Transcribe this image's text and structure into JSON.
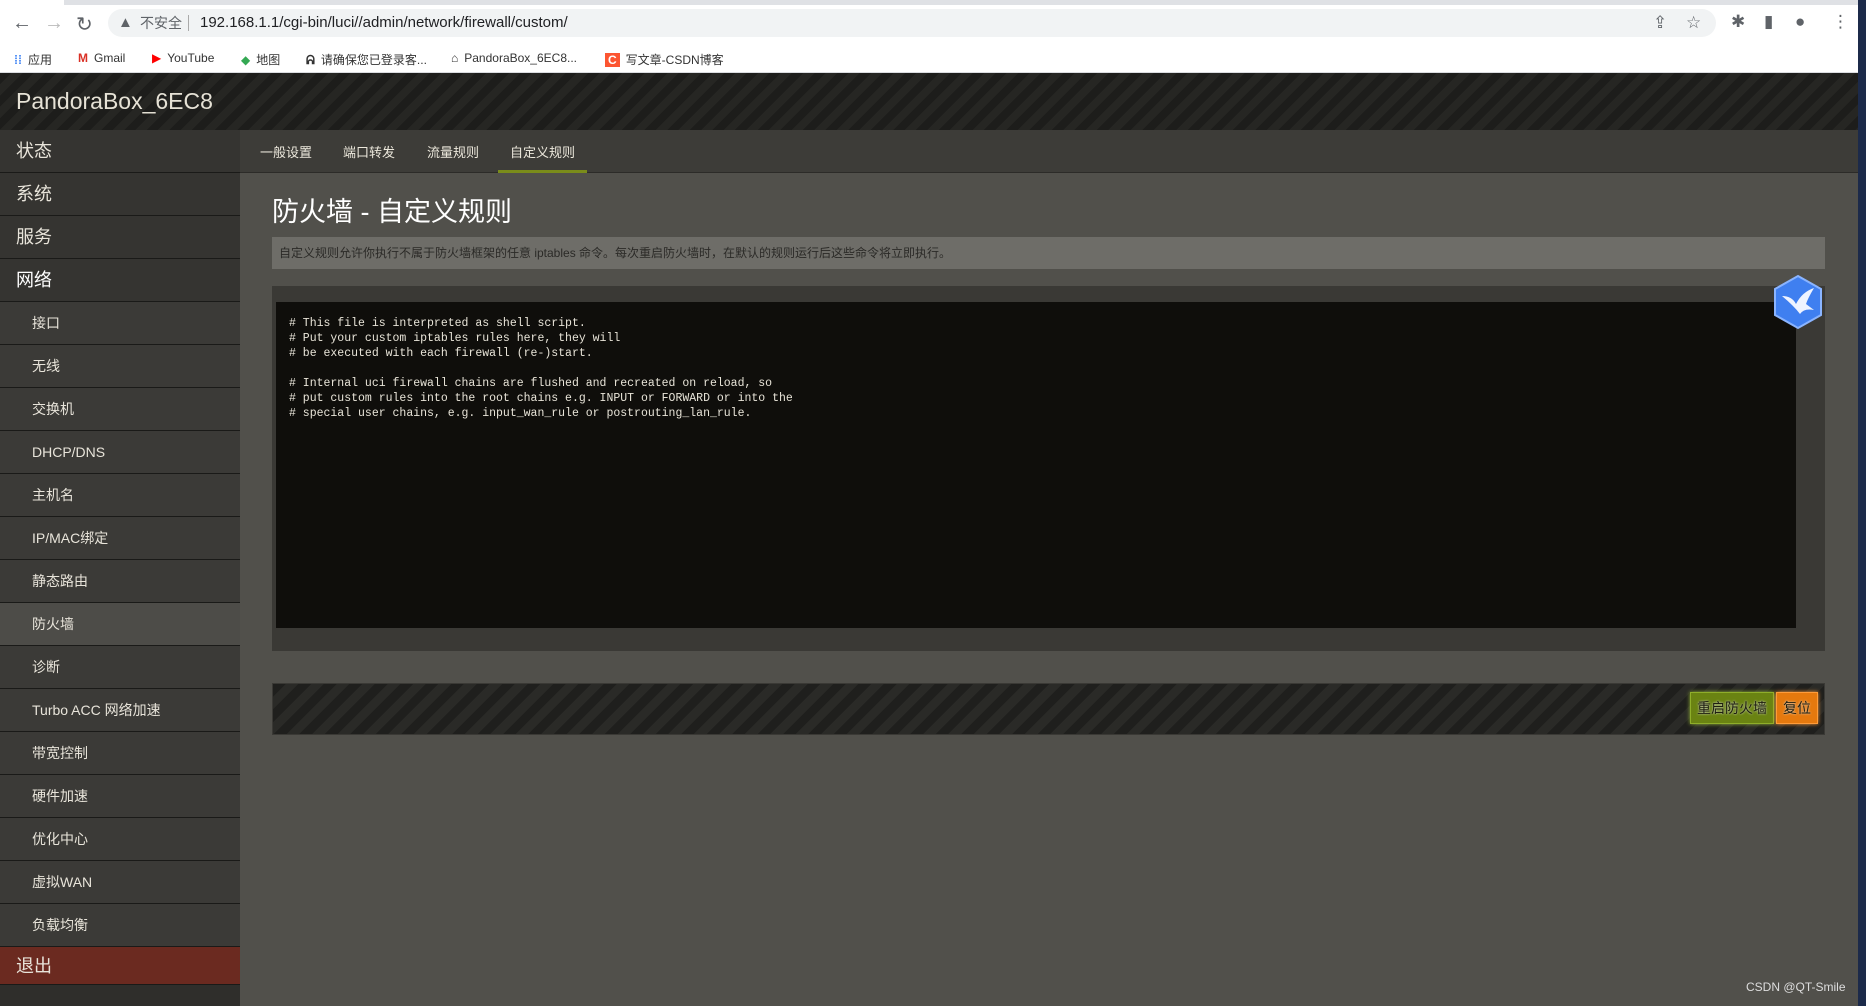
{
  "browser": {
    "insecure_label": "不安全",
    "url": "192.168.1.1/cgi-bin/luci//admin/network/firewall/custom/",
    "bookmarks": [
      {
        "icon": "apps-icon",
        "label": "应用"
      },
      {
        "icon": "gmail-icon",
        "label": "Gmail"
      },
      {
        "icon": "youtube-icon",
        "label": "YouTube"
      },
      {
        "icon": "maps-icon",
        "label": "地图"
      },
      {
        "icon": "login-icon",
        "label": "请确保您已登录客..."
      },
      {
        "icon": "router-icon",
        "label": "PandoraBox_6EC8..."
      },
      {
        "icon": "csdn-icon",
        "label": "写文章-CSDN博客"
      }
    ]
  },
  "header": {
    "brand": "PandoraBox_6EC8"
  },
  "sidebar": {
    "top": [
      "状态",
      "系统",
      "服务",
      "网络"
    ],
    "sub": [
      "接口",
      "无线",
      "交换机",
      "DHCP/DNS",
      "主机名",
      "IP/MAC绑定",
      "静态路由",
      "防火墙",
      "诊断",
      "Turbo ACC 网络加速",
      "带宽控制",
      "硬件加速",
      "优化中心",
      "虚拟WAN",
      "负载均衡"
    ],
    "active": "防火墙",
    "logout": "退出"
  },
  "tabs": [
    "一般设置",
    "端口转发",
    "流量规则",
    "自定义规则"
  ],
  "active_tab": "自定义规则",
  "page": {
    "title": "防火墙 - 自定义规则",
    "description": "自定义规则允许你执行不属于防火墙框架的任意 iptables 命令。每次重启防火墙时，在默认的规则运行后这些命令将立即执行。",
    "editor_content": "# This file is interpreted as shell script.\n# Put your custom iptables rules here, they will\n# be executed with each firewall (re-)start.\n\n# Internal uci firewall chains are flushed and recreated on reload, so\n# put custom rules into the root chains e.g. INPUT or FORWARD or into the\n# special user chains, e.g. input_wan_rule or postrouting_lan_rule."
  },
  "buttons": {
    "restart": "重启防火墙",
    "reset": "复位"
  },
  "colors": {
    "restart": "#6a8312",
    "reset": "#e5790e",
    "active_tab_underline": "#7a8c1a",
    "logout": "#6b2a20"
  },
  "watermark": "CSDN @QT-Smile"
}
